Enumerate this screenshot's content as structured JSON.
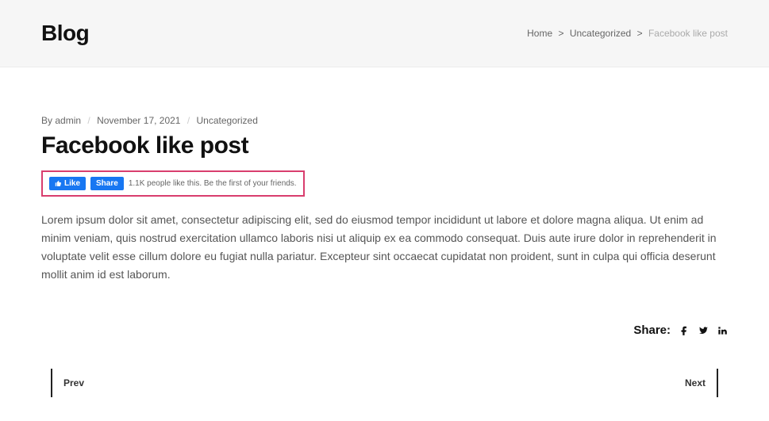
{
  "header": {
    "title": "Blog"
  },
  "breadcrumb": {
    "home": "Home",
    "category": "Uncategorized",
    "current": "Facebook like post",
    "sep": ">"
  },
  "meta": {
    "by": "By",
    "author": "admin",
    "date": "November 17, 2021",
    "category": "Uncategorized"
  },
  "post": {
    "title": "Facebook like post",
    "body": "Lorem ipsum dolor sit amet, consectetur adipiscing elit, sed do eiusmod tempor incididunt ut labore et dolore magna aliqua. Ut enim ad minim veniam, quis nostrud exercitation ullamco laboris nisi ut aliquip ex ea commodo consequat. Duis aute irure dolor in reprehenderit in voluptate velit esse cillum dolore eu fugiat nulla pariatur. Excepteur sint occaecat cupidatat non proident, sunt in culpa qui officia deserunt mollit anim id est laborum."
  },
  "fb": {
    "like": "Like",
    "share": "Share",
    "count_text": "1.1K people like this. Be the first of your friends."
  },
  "share": {
    "label": "Share:"
  },
  "nav": {
    "prev": "Prev",
    "next": "Next"
  }
}
